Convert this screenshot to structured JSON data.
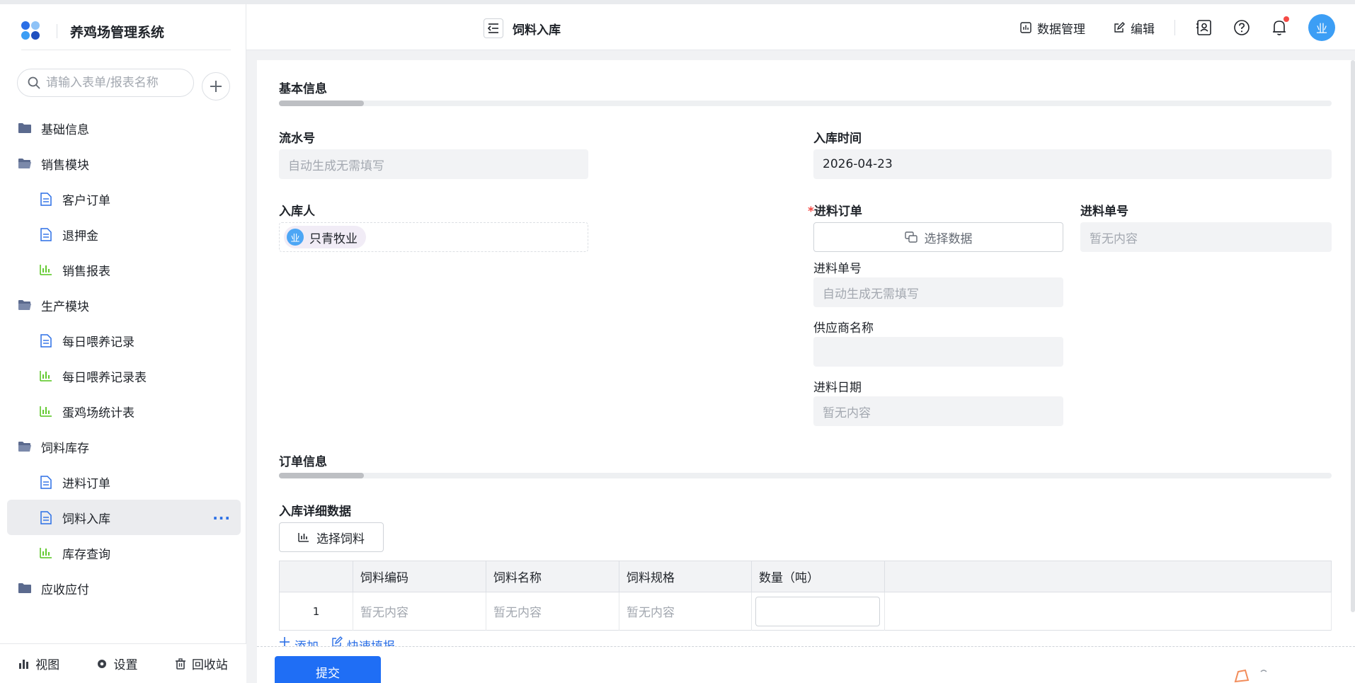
{
  "app": {
    "title": "养鸡场管理系统",
    "brand_colors": [
      "#2b6fe6",
      "#3c9ef5",
      "#8fc3f7",
      "#1f4fbf"
    ]
  },
  "sidebar": {
    "search_placeholder": "请输入表单/报表名称",
    "items": [
      {
        "label": "基础信息",
        "type": "folder"
      },
      {
        "label": "销售模块",
        "type": "folder-open"
      },
      {
        "label": "客户订单",
        "type": "form"
      },
      {
        "label": "退押金",
        "type": "form"
      },
      {
        "label": "销售报表",
        "type": "report"
      },
      {
        "label": "生产模块",
        "type": "folder-open"
      },
      {
        "label": "每日喂养记录",
        "type": "form"
      },
      {
        "label": "每日喂养记录表",
        "type": "report"
      },
      {
        "label": "蛋鸡场统计表",
        "type": "report"
      },
      {
        "label": "饲料库存",
        "type": "folder-open"
      },
      {
        "label": "进料订单",
        "type": "form"
      },
      {
        "label": "饲料入库",
        "type": "form",
        "active": true
      },
      {
        "label": "库存查询",
        "type": "report"
      },
      {
        "label": "应收应付",
        "type": "folder"
      }
    ],
    "more_label": "···",
    "footer": {
      "view": "视图",
      "settings": "设置",
      "recycle": "回收站"
    }
  },
  "header": {
    "page_title": "饲料入库",
    "data_manage": "数据管理",
    "edit": "编辑",
    "avatar_text": "业"
  },
  "form": {
    "section_basic": "基本信息",
    "serial_label": "流水号",
    "serial_placeholder": "自动生成无需填写",
    "in_time_label": "入库时间",
    "in_time_value": "2026-04-23",
    "operator_label": "入库人",
    "operator_value": "只青牧业",
    "operator_avatar": "业",
    "order_req_mark": "*",
    "order_label": "进料订单",
    "order_select": "选择数据",
    "order_no_label": "进料单号",
    "order_no_value": "暂无内容",
    "sub_order_no_label": "进料单号",
    "sub_order_no_placeholder": "自动生成无需填写",
    "supplier_label": "供应商名称",
    "supplier_value": "",
    "date_label": "进料日期",
    "date_value": "暂无内容",
    "section_order": "订单信息",
    "detail_label": "入库详细数据",
    "select_feed": "选择饲料",
    "table": {
      "headers": [
        "",
        "饲料编码",
        "饲料名称",
        "饲料规格",
        "数量（吨）",
        ""
      ],
      "rows": [
        {
          "idx": "1",
          "code": "暂无内容",
          "name": "暂无内容",
          "spec": "暂无内容",
          "qty": ""
        }
      ]
    },
    "add_link": "添加",
    "quick_fill": "快速填报",
    "submit": "提交"
  }
}
